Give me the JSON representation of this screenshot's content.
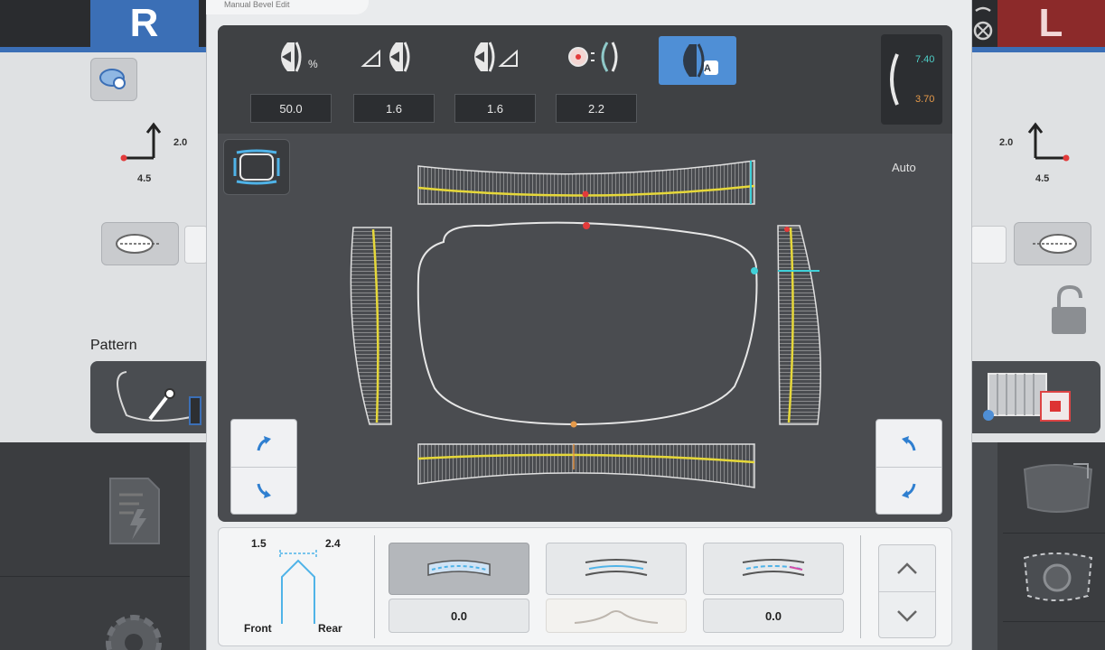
{
  "dialog": {
    "tab_label": "Manual Bevel Edit"
  },
  "left_side": {
    "eye_label": "R",
    "offset_vertical": "2.0",
    "offset_horizontal": "4.5",
    "pattern_label": "Pattern"
  },
  "right_side": {
    "eye_label": "L",
    "offset_vertical": "2.0",
    "offset_horizontal": "4.5"
  },
  "toolbar": {
    "tools": [
      {
        "icon": "bevel-percent-icon",
        "suffix": "%",
        "value": "50.0"
      },
      {
        "icon": "bevel-front-offset-icon",
        "suffix": "",
        "value": "1.6"
      },
      {
        "icon": "bevel-rear-offset-icon",
        "suffix": "",
        "value": "1.6"
      },
      {
        "icon": "bevel-curve-icon",
        "suffix": "",
        "value": "2.2"
      },
      {
        "icon": "bevel-auto-icon",
        "suffix": "A",
        "value": ""
      }
    ],
    "curve_front": "7.40",
    "curve_rear": "3.70"
  },
  "canvas": {
    "mode_label": "Auto"
  },
  "bottom": {
    "bevel_left_value": "1.5",
    "bevel_right_value": "2.4",
    "front_label": "Front",
    "rear_label": "Rear",
    "option_values": [
      "0.0",
      "",
      "0.0"
    ]
  },
  "colors": {
    "accent_blue": "#4f8fd6",
    "bevel_yellow": "#e6d83a",
    "marker_red": "#e23b3b",
    "marker_cyan": "#3fd0d8",
    "marker_orange": "#e69a4a"
  }
}
